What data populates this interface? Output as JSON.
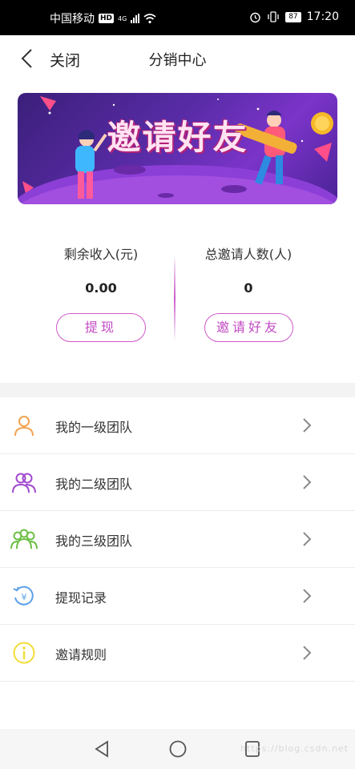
{
  "status_bar": {
    "carrier": "中国移动",
    "hd": "HD",
    "network": "4G",
    "battery": "87",
    "time": "17:20"
  },
  "nav": {
    "close_label": "关闭",
    "title": "分销中心"
  },
  "banner": {
    "title": "邀请好友"
  },
  "stats": {
    "remaining_income": {
      "label": "剩余收入(元)",
      "value": "0.00",
      "button": "提现"
    },
    "total_invites": {
      "label": "总邀请人数(人)",
      "value": "0",
      "button": "邀请好友"
    }
  },
  "menu": {
    "items": [
      {
        "label": "我的一级团队",
        "icon": "person-icon",
        "color": "#f3a34f"
      },
      {
        "label": "我的二级团队",
        "icon": "people-icon",
        "color": "#a24ad0"
      },
      {
        "label": "我的三级团队",
        "icon": "group-icon",
        "color": "#6cbf45"
      },
      {
        "label": "提现记录",
        "icon": "withdraw-record-icon",
        "color": "#5aa0e8"
      },
      {
        "label": "邀请规则",
        "icon": "info-icon",
        "color": "#f2dc35"
      }
    ]
  },
  "watermark": "https://blog.csdn.net"
}
